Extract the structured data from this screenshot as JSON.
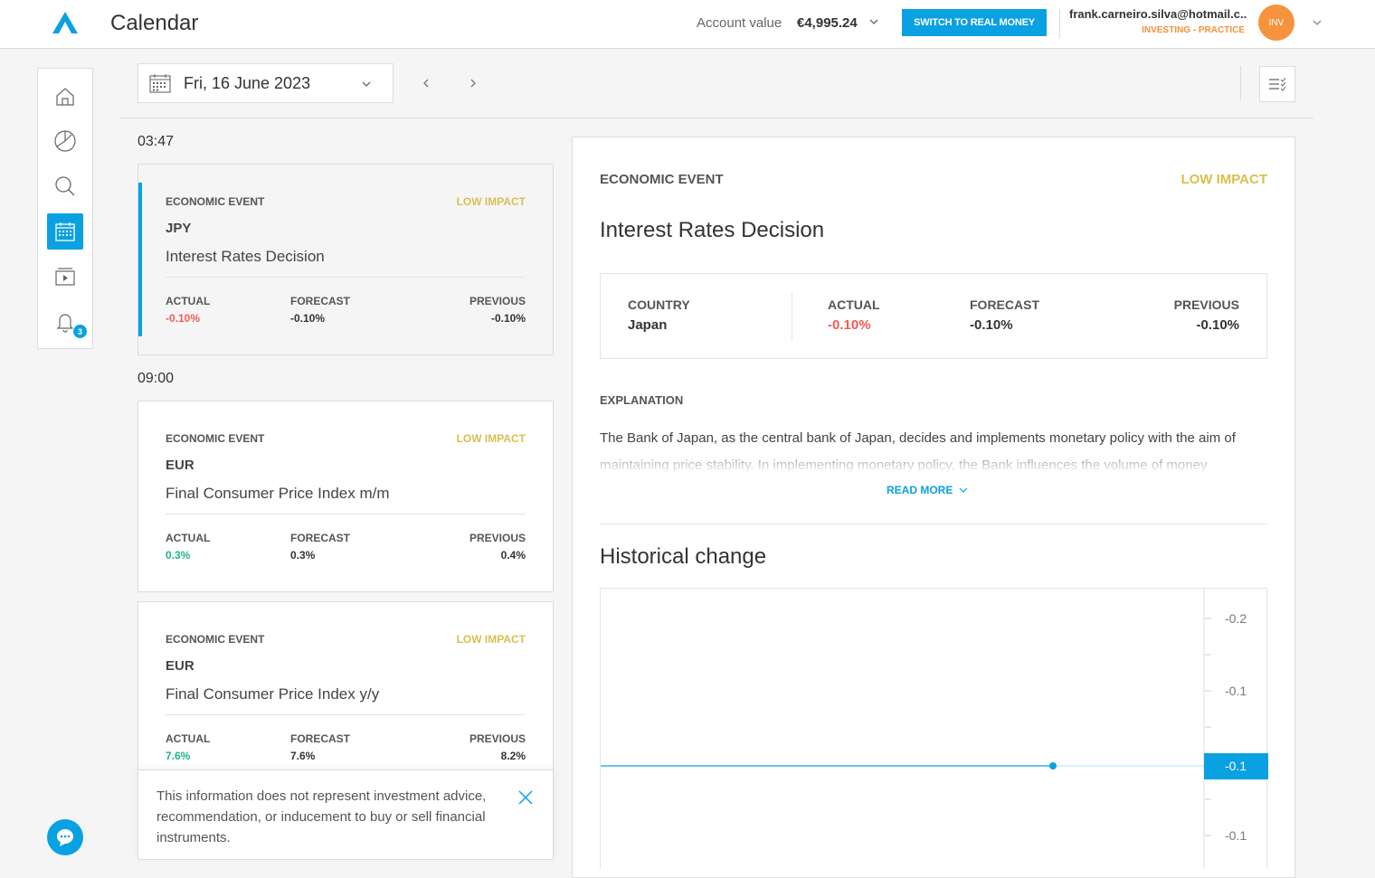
{
  "header": {
    "title": "Calendar",
    "account_label": "Account value",
    "account_value": "€4,995.24",
    "switch_button": "SWITCH TO REAL MONEY",
    "user_email": "frank.carneiro.silva@hotmail.c...",
    "user_mode": "INVESTING - PRACTICE",
    "avatar_initials": "INV"
  },
  "sidebar": {
    "items": [
      {
        "name": "home-icon"
      },
      {
        "name": "portfolio-icon"
      },
      {
        "name": "search-icon"
      },
      {
        "name": "calendar-icon",
        "active": true
      },
      {
        "name": "media-icon"
      },
      {
        "name": "bell-icon"
      }
    ],
    "notification_count": "3"
  },
  "toolbar": {
    "date": "Fri, 16 June 2023"
  },
  "events": [
    {
      "time": "03:47",
      "type": "ECONOMIC EVENT",
      "impact": "LOW IMPACT",
      "currency": "JPY",
      "name": "Interest Rates Decision",
      "actual_label": "ACTUAL",
      "forecast_label": "FORECAST",
      "previous_label": "PREVIOUS",
      "actual": "-0.10%",
      "forecast": "-0.10%",
      "previous": "-0.10%"
    },
    {
      "time": "09:00",
      "type": "ECONOMIC EVENT",
      "impact": "LOW IMPACT",
      "currency": "EUR",
      "name": "Final Consumer Price Index m/m",
      "actual_label": "ACTUAL",
      "forecast_label": "FORECAST",
      "previous_label": "PREVIOUS",
      "actual": "0.3%",
      "forecast": "0.3%",
      "previous": "0.4%"
    },
    {
      "type": "ECONOMIC EVENT",
      "impact": "LOW IMPACT",
      "currency": "EUR",
      "name": "Final Consumer Price Index y/y",
      "actual_label": "ACTUAL",
      "forecast_label": "FORECAST",
      "previous_label": "PREVIOUS",
      "actual": "7.6%",
      "forecast": "7.6%",
      "previous": "8.2%"
    }
  ],
  "disclaimer": "This information does not represent investment advice, recommendation, or inducement to buy or sell financial instruments.",
  "detail": {
    "type": "ECONOMIC EVENT",
    "impact": "LOW IMPACT",
    "title": "Interest Rates Decision",
    "country_label": "COUNTRY",
    "country": "Japan",
    "actual_label": "ACTUAL",
    "actual": "-0.10%",
    "forecast_label": "FORECAST",
    "forecast": "-0.10%",
    "previous_label": "PREVIOUS",
    "previous": "-0.10%",
    "explanation_label": "EXPLANATION",
    "explanation": "The Bank of Japan, as the central bank of Japan, decides and implements monetary policy with the aim of maintaining price stability. In implementing monetary policy, the Bank influences the volume of money",
    "read_more": "READ MORE",
    "historical_title": "Historical change"
  },
  "colors": {
    "accent": "#0aa1e2",
    "negative": "#f25c54",
    "positive": "#1eb780",
    "impact": "#d8c050",
    "avatar": "#f6933f"
  },
  "chart_data": {
    "type": "line",
    "y_ticks": [
      "-0.2",
      "-0.1",
      "-0.1"
    ],
    "current_value_label": "-0.1",
    "series": [
      {
        "values": [
          -0.1,
          -0.1
        ]
      }
    ]
  }
}
